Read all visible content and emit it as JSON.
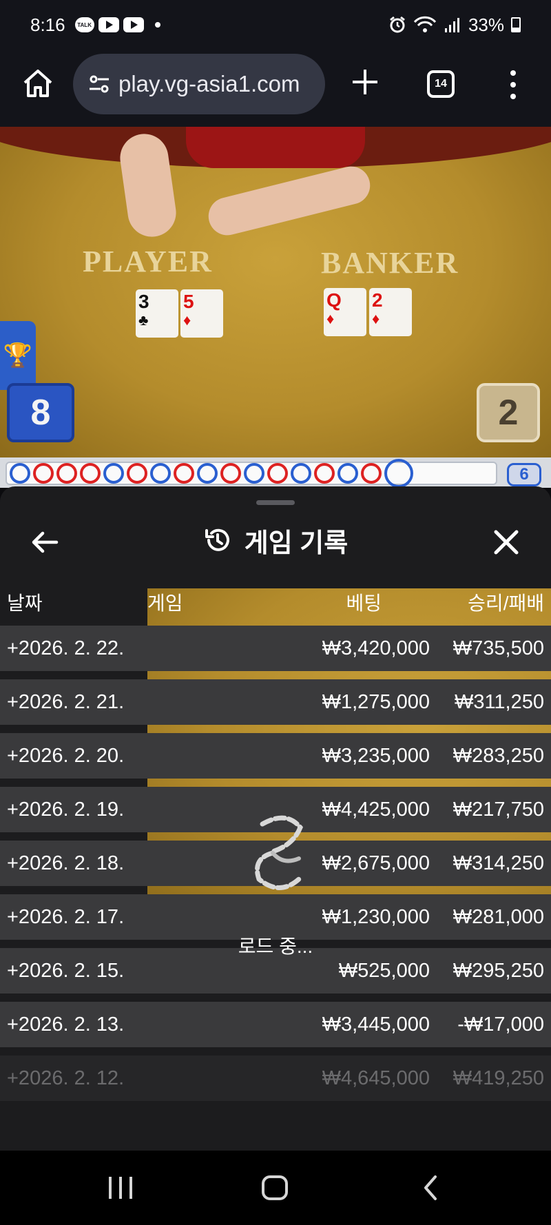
{
  "status_bar": {
    "time": "8:16",
    "bubble_label": "TALK",
    "battery": "33%"
  },
  "browser": {
    "url": "play.vg-asia1.com",
    "tab_count": "14"
  },
  "game": {
    "player_label": "PLAYER",
    "banker_label": "BANKER",
    "player_cards": [
      {
        "rank": "3",
        "suit": "♣",
        "color": "black"
      },
      {
        "rank": "5",
        "suit": "♦",
        "color": "red"
      }
    ],
    "banker_cards": [
      {
        "rank": "Q",
        "suit": "♦",
        "color": "red"
      },
      {
        "rank": "2",
        "suit": "♦",
        "color": "red"
      }
    ],
    "player_score": "8",
    "banker_score": "2",
    "road_count": "6",
    "trophy_icon": "🏆"
  },
  "history_sheet": {
    "title": "게임 기록",
    "columns": {
      "date": "날짜",
      "game": "게임",
      "bet": "베팅",
      "win_loss": "승리/패배"
    },
    "rows": [
      {
        "date": "+2026. 2. 22.",
        "bet": "₩3,420,000",
        "win_loss": "₩735,500"
      },
      {
        "date": "+2026. 2. 21.",
        "bet": "₩1,275,000",
        "win_loss": "₩311,250"
      },
      {
        "date": "+2026. 2. 20.",
        "bet": "₩3,235,000",
        "win_loss": "₩283,250"
      },
      {
        "date": "+2026. 2. 19.",
        "bet": "₩4,425,000",
        "win_loss": "₩217,750"
      },
      {
        "date": "+2026. 2. 18.",
        "bet": "₩2,675,000",
        "win_loss": "₩314,250"
      },
      {
        "date": "+2026. 2. 17.",
        "bet": "₩1,230,000",
        "win_loss": "₩281,000"
      },
      {
        "date": "+2026. 2. 15.",
        "bet": "₩525,000",
        "win_loss": "₩295,250"
      },
      {
        "date": "+2026. 2. 13.",
        "bet": "₩3,445,000",
        "win_loss": "-₩17,000"
      },
      {
        "date": "+2026. 2. 12.",
        "bet": "₩4,645,000",
        "win_loss": "₩419,250"
      }
    ],
    "loading_text": "로드 중..."
  },
  "colors": {
    "sheet_bg": "#1c1c1e",
    "row_bg": "#3a3a3c",
    "player_blue": "#2a55c2",
    "felt_gold": "#c9a13a"
  }
}
